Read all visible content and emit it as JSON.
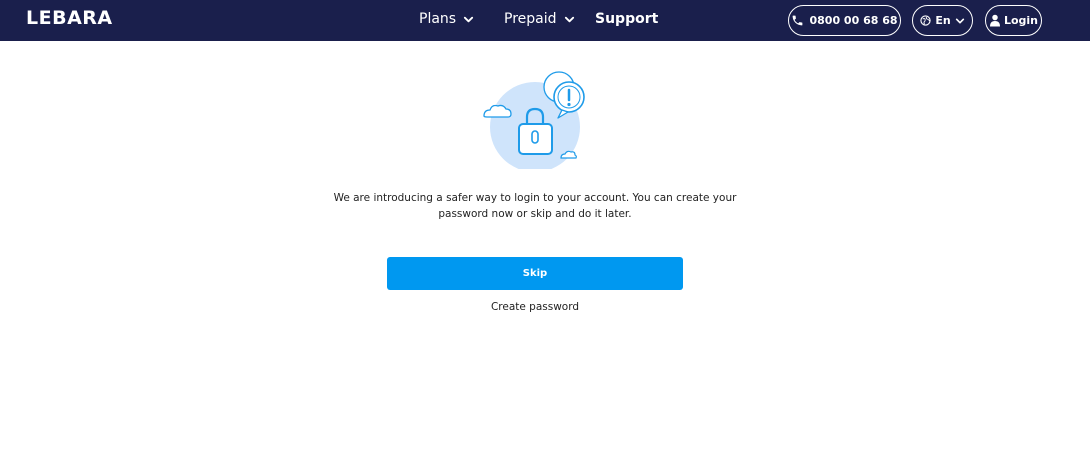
{
  "header": {
    "logo": "LEBARA",
    "nav": {
      "plans": "Plans",
      "prepaid": "Prepaid",
      "support": "Support"
    },
    "phone": "0800 00 68 68",
    "language": "En",
    "login": "Login",
    "icons": {
      "phone": "phone-icon",
      "globe": "globe-icon",
      "user": "user-icon",
      "chevron": "chevron-down-icon"
    }
  },
  "main": {
    "message": "We are introducing a safer way to login to your account. You can create your password now or skip and do it later.",
    "skip_label": "Skip",
    "create_password_label": "Create password",
    "illustration": "lock-notification-illustration"
  },
  "colors": {
    "navbar": "#1a1f4c",
    "primary_button": "#0098f0",
    "illustration_circle": "#cfe4fb",
    "illustration_stroke": "#1e9be9"
  }
}
